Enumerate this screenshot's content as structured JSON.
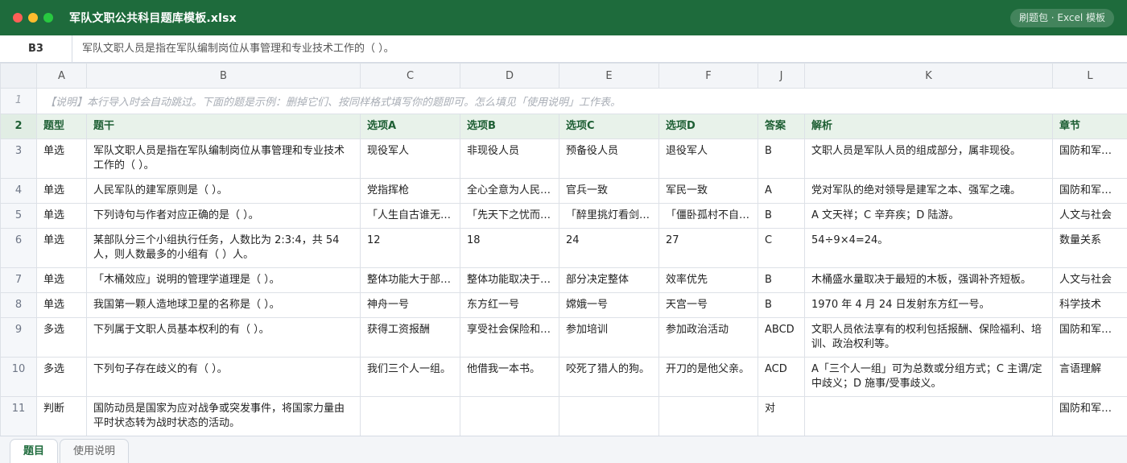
{
  "window": {
    "title": "军队文职公共科目题库模板.xlsx",
    "badge": "刷题包 · Excel 模板"
  },
  "formula_bar": {
    "cell_ref": "B3",
    "value": "军队文职人员是指在军队编制岗位从事管理和专业技术工作的（ ）。"
  },
  "columns": [
    "A",
    "B",
    "C",
    "D",
    "E",
    "F",
    "J",
    "K",
    "L"
  ],
  "note_row": {
    "row": "1",
    "text": "【说明】本行导入时会自动跳过。下面的题是示例：删掉它们、按同样格式填写你的题即可。怎么填见「使用说明」工作表。"
  },
  "header_row": {
    "row": "2",
    "cells": [
      "题型",
      "题干",
      "选项A",
      "选项B",
      "选项C",
      "选项D",
      "答案",
      "解析",
      "章节"
    ]
  },
  "rows": [
    {
      "row": "3",
      "cells": [
        "单选",
        "军队文职人员是指在军队编制岗位从事管理和专业技术工作的（ ）。",
        "现役军人",
        "非现役人员",
        "预备役人员",
        "退役军人",
        "B",
        "文职人员是军队人员的组成部分，属非现役。",
        "国防和军队建设"
      ]
    },
    {
      "row": "4",
      "cells": [
        "单选",
        "人民军队的建军原则是（ ）。",
        "党指挥枪",
        "全心全意为人民服务",
        "官兵一致",
        "军民一致",
        "A",
        "党对军队的绝对领导是建军之本、强军之魂。",
        "国防和军队建设"
      ]
    },
    {
      "row": "5",
      "cells": [
        "单选",
        "下列诗句与作者对应正确的是（ ）。",
        "「人生自古谁无死」— 文天祥",
        "「先天下之忧而忧」— 范仲淹",
        "「醉里挑灯看剑」— 辛弃疾",
        "「僵卧孤村不自哀」— 陆游",
        "B",
        "A 文天祥；C 辛弃疾；D 陆游。",
        "人文与社会"
      ]
    },
    {
      "row": "6",
      "cells": [
        "单选",
        "某部队分三个小组执行任务，人数比为 2:3:4，共 54 人，则人数最多的小组有（ ）人。",
        "12",
        "18",
        "24",
        "27",
        "C",
        "54÷9×4=24。",
        "数量关系"
      ]
    },
    {
      "row": "7",
      "cells": [
        "单选",
        "「木桶效应」说明的管理学道理是（ ）。",
        "整体功能大于部分之和",
        "整体功能取决于最短板",
        "部分决定整体",
        "效率优先",
        "B",
        "木桶盛水量取决于最短的木板，强调补齐短板。",
        "人文与社会"
      ]
    },
    {
      "row": "8",
      "cells": [
        "单选",
        "我国第一颗人造地球卫星的名称是（ ）。",
        "神舟一号",
        "东方红一号",
        "嫦娥一号",
        "天宫一号",
        "B",
        "1970 年 4 月 24 日发射东方红一号。",
        "科学技术"
      ]
    },
    {
      "row": "9",
      "cells": [
        "多选",
        "下列属于文职人员基本权利的有（ ）。",
        "获得工资报酬",
        "享受社会保险和福利",
        "参加培训",
        "参加政治活动",
        "ABCD",
        "文职人员依法享有的权利包括报酬、保险福利、培训、政治权利等。",
        "国防和军队建设"
      ]
    },
    {
      "row": "10",
      "cells": [
        "多选",
        "下列句子存在歧义的有（ ）。",
        "我们三个人一组。",
        "他借我一本书。",
        "咬死了猎人的狗。",
        "开刀的是他父亲。",
        "ACD",
        "A「三个人一组」可为总数或分组方式；C 主谓/定中歧义；D 施事/受事歧义。",
        "言语理解"
      ]
    },
    {
      "row": "11",
      "cells": [
        "判断",
        "国防动员是国家为应对战争或突发事件，将国家力量由平时状态转为战时状态的活动。",
        "",
        "",
        "",
        "",
        "对",
        "",
        "国防和军队建设"
      ]
    }
  ],
  "sheet_tabs": [
    {
      "label": "题目",
      "active": true
    },
    {
      "label": "使用说明",
      "active": false
    }
  ]
}
